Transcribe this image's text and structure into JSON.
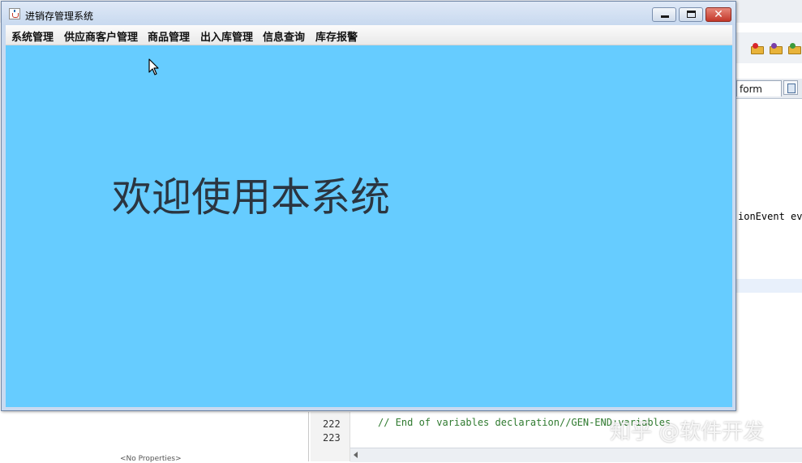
{
  "app_window": {
    "title": "进销存管理系统",
    "menu": [
      "系统管理",
      "供应商客户管理",
      "商品管理",
      "出入库管理",
      "信息查询",
      "库存报警"
    ],
    "welcome_text": "欢迎使用本系统",
    "content_bg": "#66ccff",
    "window_buttons": {
      "minimize": "minimize-icon",
      "maximize": "maximize-icon",
      "close_glyph": "✕"
    }
  },
  "ide_background": {
    "tab_label": "form",
    "code_fragment_top": "ionEvent ev",
    "line_numbers": [
      "222",
      "223"
    ],
    "code_line": "// End of variables declaration//GEN-END:variables",
    "properties_text": "<No Properties>"
  },
  "watermark": "知乎 @软件开发"
}
